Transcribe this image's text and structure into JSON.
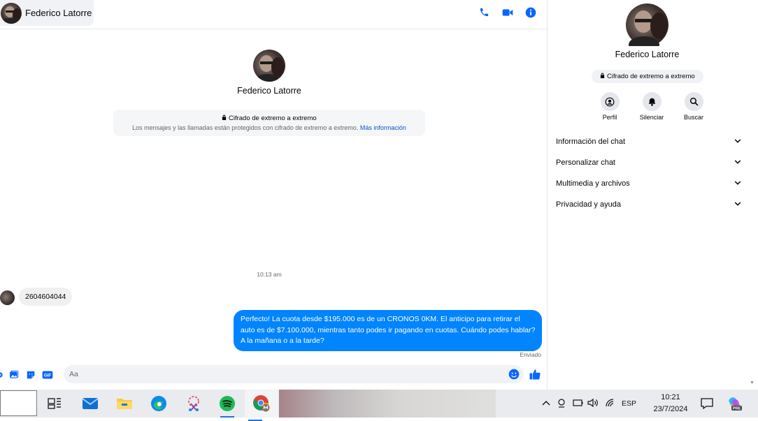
{
  "header": {
    "contact_name": "Federico Latorre",
    "icons": [
      "phone-icon",
      "video-icon",
      "info-icon"
    ]
  },
  "conversation": {
    "profile_name": "Federico Latorre",
    "encryption_title": "Cifrado de extremo a extremo",
    "encryption_desc": "Los mensajes y las llamadas están protegidos con cifrado de extremo a extremo.",
    "encryption_link": "Más información",
    "timestamp": "10:13 am",
    "messages": [
      {
        "direction": "incoming",
        "text": "2604604044"
      },
      {
        "direction": "outgoing",
        "text": "Perfecto! La cuota desde $195.000 es de un CRONOS 0KM. El anticipo para retirar el auto es de $7.100.000, mientras tanto podes ir pagando en cuotas. Cuándo podes hablar? A la mañana o a la tarde?"
      }
    ],
    "status": "Enviado"
  },
  "composer": {
    "placeholder": "Aa",
    "value": "",
    "icons": [
      "plus-icon",
      "image-icon",
      "sticker-icon",
      "gif-icon",
      "emoji-icon",
      "like-icon"
    ],
    "gif_label": "GIF"
  },
  "right_panel": {
    "name": "Federico Latorre",
    "badge": "Cifrado de extremo a extremo",
    "actions": [
      {
        "label": "Perfil",
        "icon": "profile-icon"
      },
      {
        "label": "Silenciar",
        "icon": "bell-icon"
      },
      {
        "label": "Buscar",
        "icon": "search-icon"
      }
    ],
    "menu": [
      {
        "label": "Información del chat"
      },
      {
        "label": "Personalizar chat"
      },
      {
        "label": "Multimedia y archivos"
      },
      {
        "label": "Privacidad y ayuda"
      }
    ]
  },
  "taskbar": {
    "apps": [
      "task-view",
      "mail",
      "file-explorer",
      "edge",
      "snipping-tool",
      "spotify",
      "chrome"
    ],
    "language": "ESP",
    "time": "10:21",
    "date": "23/7/2024",
    "copilot_badge": "PRE"
  },
  "colors": {
    "accent": "#0084ff",
    "link": "#0a55c8",
    "icon_blue": "#0866ff"
  }
}
